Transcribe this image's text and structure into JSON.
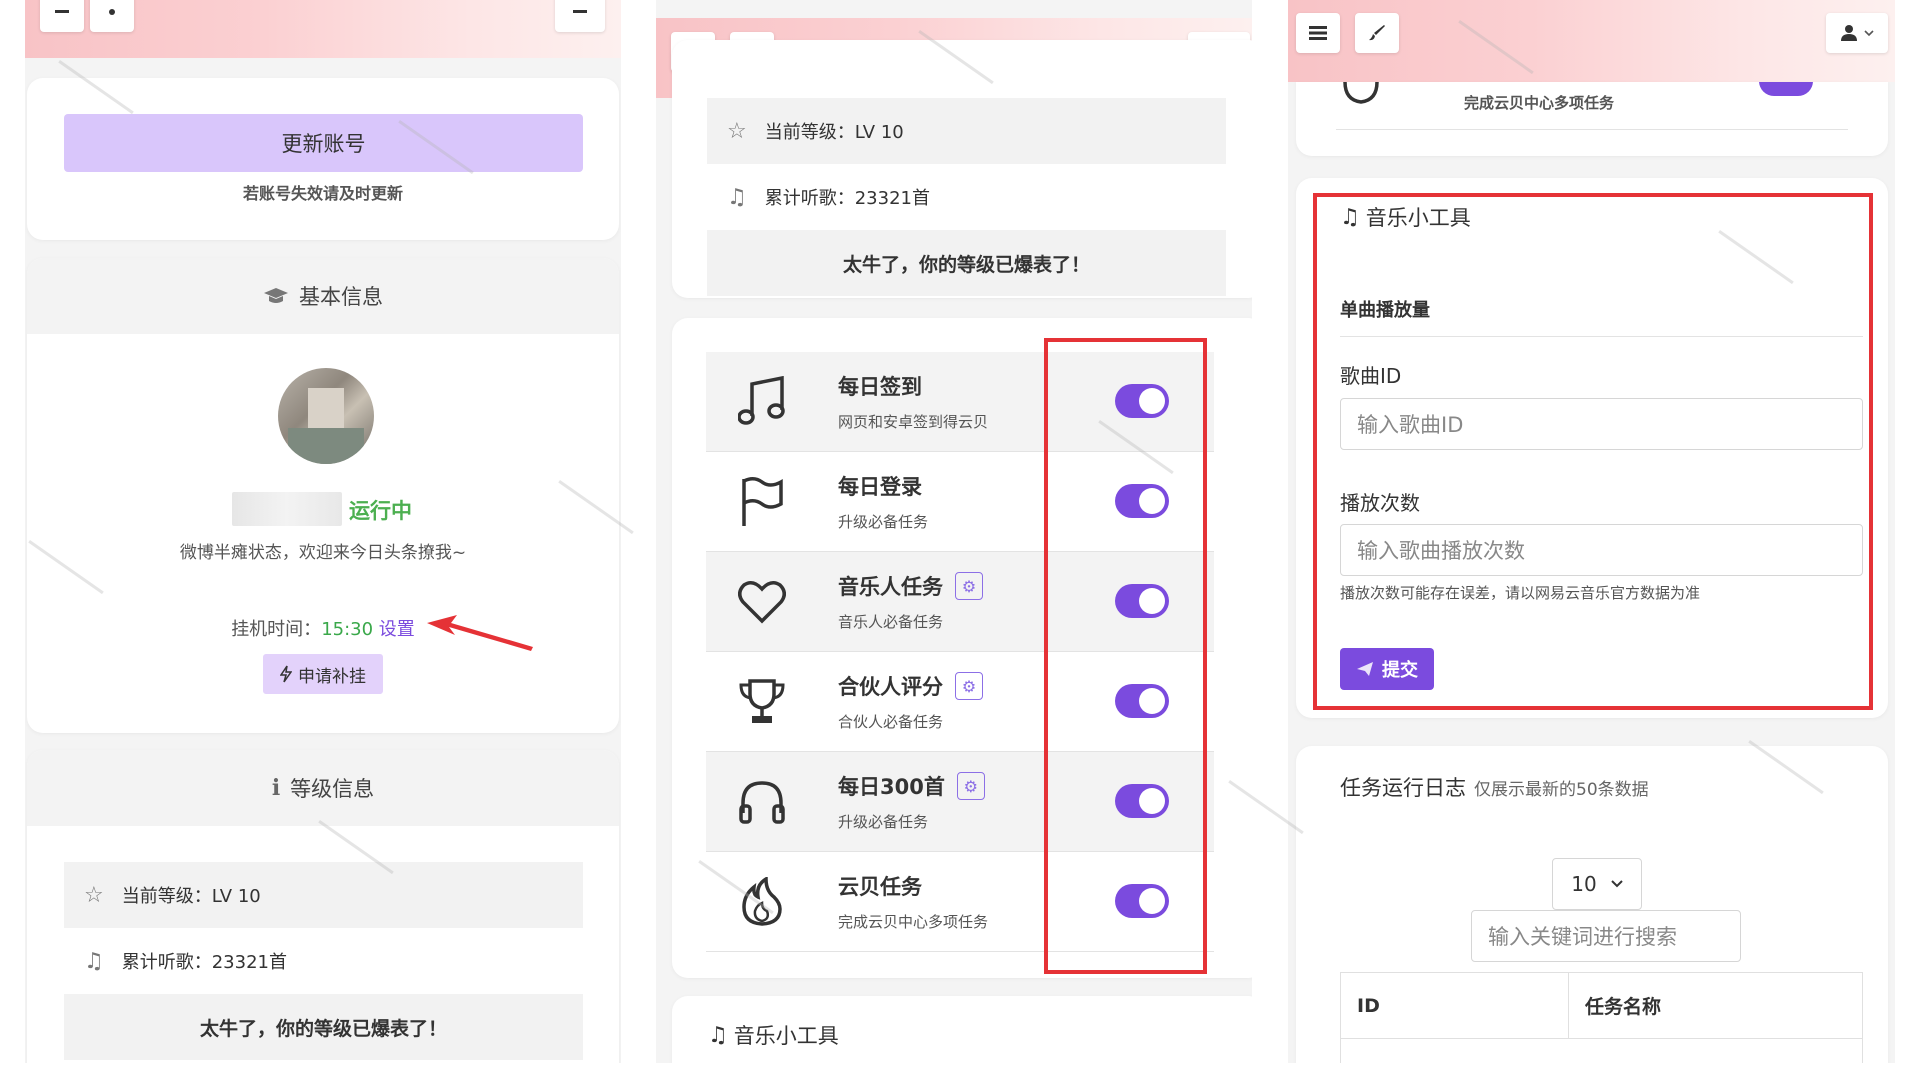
{
  "panel1": {
    "update_account_button": "更新账号",
    "update_hint": "若账号失效请及时更新",
    "basic_info_title": "基本信息",
    "status": "运行中",
    "signature": "微博半瘫状态，欢迎来今日头条撩我~",
    "hang_time_label": "挂机时间：",
    "hang_time_value": "15:30",
    "settings_link": "设置",
    "apply_button": "申请补挂",
    "level_info_title": "等级信息",
    "current_level": "当前等级：LV 10",
    "total_listened": "累计听歌：23321首",
    "level_note": "太牛了，你的等级已爆表了！"
  },
  "panel2": {
    "current_level": "当前等级：LV 10",
    "total_listened": "累计听歌：23321首",
    "level_note": "太牛了，你的等级已爆表了！",
    "tasks": [
      {
        "title": "每日签到",
        "subtitle": "网页和安卓签到得云贝",
        "icon": "music-note-icon",
        "enabled": true,
        "has_settings": false
      },
      {
        "title": "每日登录",
        "subtitle": "升级必备任务",
        "icon": "flag-icon",
        "enabled": true,
        "has_settings": false
      },
      {
        "title": "音乐人任务",
        "subtitle": "音乐人必备任务",
        "icon": "heart-icon",
        "enabled": true,
        "has_settings": true
      },
      {
        "title": "合伙人评分",
        "subtitle": "合伙人必备任务",
        "icon": "trophy-icon",
        "enabled": true,
        "has_settings": true
      },
      {
        "title": "每日300首",
        "subtitle": "升级必备任务",
        "icon": "headphones-icon",
        "enabled": true,
        "has_settings": true
      },
      {
        "title": "云贝任务",
        "subtitle": "完成云贝中心多项任务",
        "icon": "fire-icon",
        "enabled": true,
        "has_settings": false
      }
    ],
    "music_tools_title": "音乐小工具"
  },
  "panel3": {
    "top_task_subtitle": "完成云贝中心多项任务",
    "music_tools_title": "音乐小工具",
    "section_title": "单曲播放量",
    "song_id_label": "歌曲ID",
    "song_id_placeholder": "输入歌曲ID",
    "play_count_label": "播放次数",
    "play_count_placeholder": "输入歌曲播放次数",
    "play_count_hint": "播放次数可能存在误差，请以网易云音乐官方数据为准",
    "submit_button": "提交",
    "log_title": "任务运行日志",
    "log_subtitle": "仅展示最新的50条数据",
    "page_size_value": "10",
    "search_placeholder": "输入关键词进行搜索",
    "table_headers": [
      "ID",
      "任务名称"
    ]
  },
  "colors": {
    "accent": "#7b4bde",
    "status_green": "#4caf50",
    "time_green": "#3aa84a",
    "highlight_red": "#e53236",
    "button_lavender": "#d9c6fb"
  }
}
